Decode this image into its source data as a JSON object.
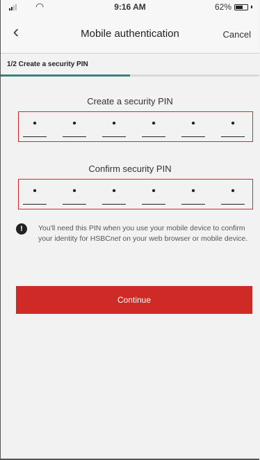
{
  "status_bar": {
    "time": "9:16 AM",
    "battery": "62%",
    "battery_level": 0.62
  },
  "nav": {
    "title": "Mobile authentication",
    "cancel_label": "Cancel",
    "back_icon": "chevron-left-icon"
  },
  "step": {
    "label": "1/2 Create a security PIN",
    "progress": 0.5,
    "progress_color": "#3b7f7e"
  },
  "create_pin": {
    "title": "Create a security PIN",
    "digits": [
      "•",
      "•",
      "•",
      "•",
      "•",
      "•"
    ]
  },
  "confirm_pin": {
    "title": "Confirm security PIN",
    "digits": [
      "•",
      "•",
      "•",
      "•",
      "•",
      "•"
    ]
  },
  "info": {
    "icon": "exclamation-icon",
    "text_before": "You'll need this PIN when you use your mobile device to confirm your identity for HSBC",
    "text_italic": "net",
    "text_after": " on your web browser or mobile device."
  },
  "actions": {
    "continue_label": "Continue",
    "accent_color": "#cf2a25"
  }
}
